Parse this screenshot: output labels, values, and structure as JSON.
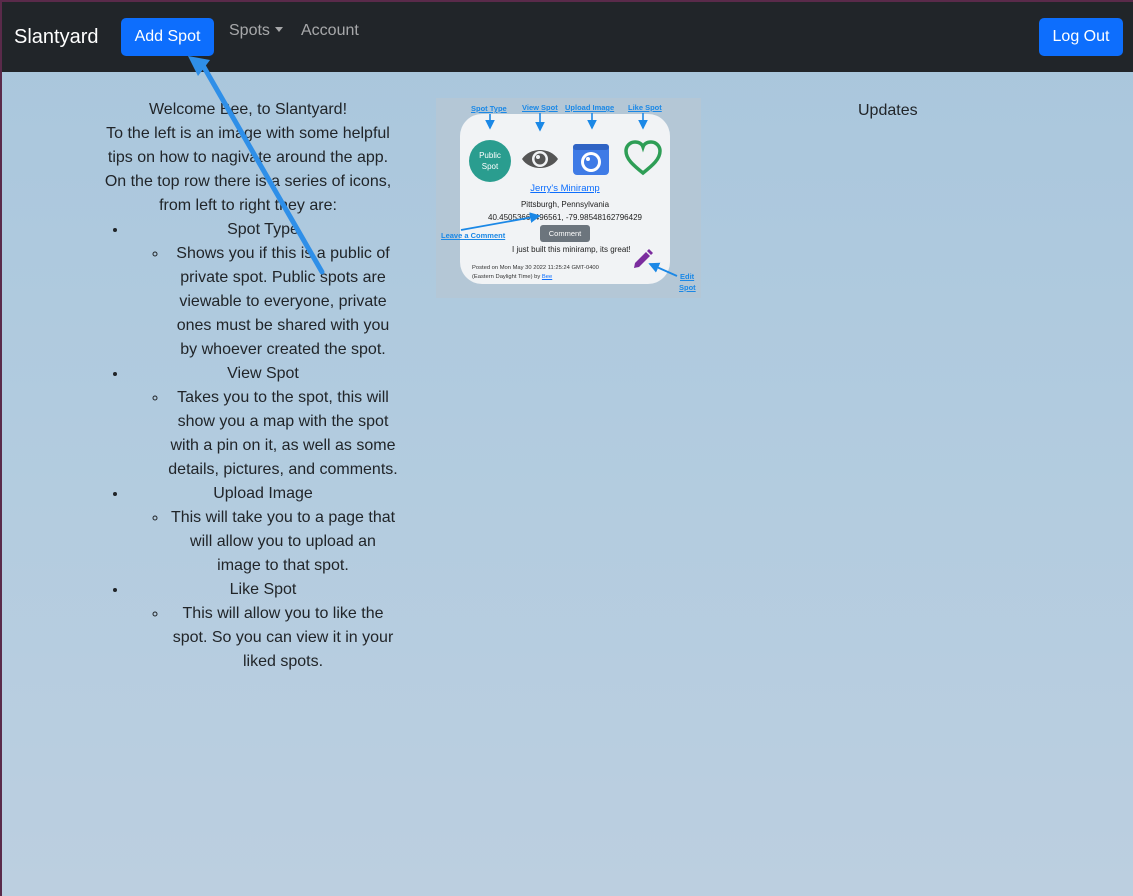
{
  "navbar": {
    "brand": "Slantyard",
    "add_spot": "Add Spot",
    "spots": "Spots",
    "account": "Account",
    "logout": "Log Out"
  },
  "welcome": {
    "line1": "Welcome Bee, to Slantyard!",
    "intro": "To the left is an image with some helpful tips on how to nagivate around the app. On the top row there is a series of icons, from left to right they are:",
    "items": [
      {
        "title": "Spot Type",
        "desc": "Shows you if this is a public of private spot. Public spots are viewable to everyone, private ones must be shared with you by whoever created the spot."
      },
      {
        "title": "View Spot",
        "desc": "Takes you to the spot, this will show you a map with the spot with a pin on it, as well as some details, pictures, and comments."
      },
      {
        "title": "Upload Image",
        "desc": "This will take you to a page that will allow you to upload an image to that spot."
      },
      {
        "title": "Like Spot",
        "desc": "This will allow you to like the spot. So you can view it in your liked spots."
      }
    ]
  },
  "tutorial": {
    "labels": {
      "spot_type": "Spot Type",
      "view_spot": "View Spot",
      "upload_image": "Upload Image",
      "like_spot": "Like Spot",
      "leave_comment": "Leave a Comment",
      "edit_spot_1": "Edit",
      "edit_spot_2": "Spot"
    },
    "card": {
      "badge_line1": "Public",
      "badge_line2": "Spot",
      "title": "Jerry's Miniramp",
      "location": "Pittsburgh, Pennsylvania",
      "coords": "40.45053668496561, -79.98548162796429",
      "comment_button": "Comment",
      "comment_text": "I just built this miniramp, its great!",
      "posted_prefix": "Posted on Mon May 30 2022 11:25:24 GMT-0400 (Eastern Daylight Time) by ",
      "posted_user": "Bee"
    },
    "icons": [
      "eye-icon",
      "camera-icon",
      "heart-icon",
      "pencil-icon"
    ]
  },
  "updates": {
    "title": "Updates"
  },
  "colors": {
    "navbar": "#212529",
    "primary": "#0d6efd",
    "annotation": "#1b88e6",
    "badge": "#2a9d8f",
    "heart": "#2e9e56",
    "pencil": "#7b2c9e"
  }
}
